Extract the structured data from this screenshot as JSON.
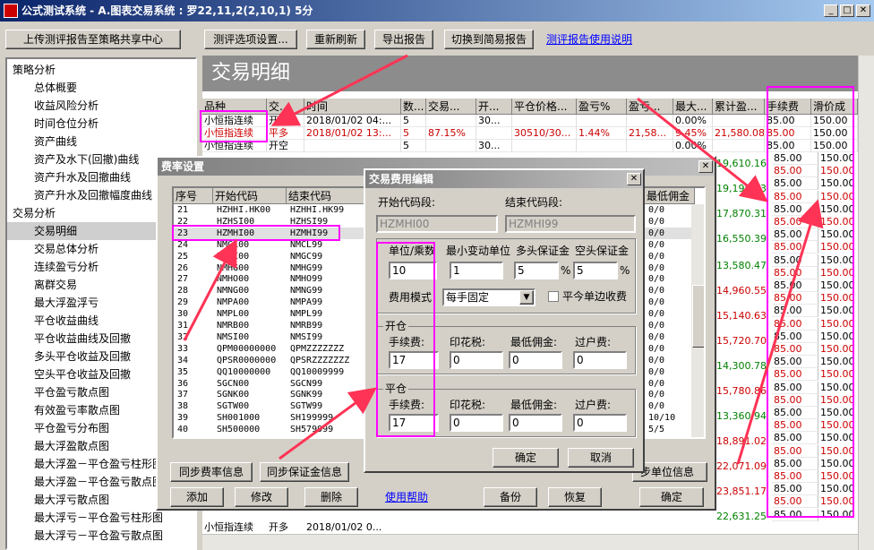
{
  "window": {
    "title": "公式测试系统 - A.图表交易系统 : 罗22,11,2(2,10,1) 5分"
  },
  "toolbar": {
    "upload": "上传测评报告至策略共享中心",
    "options": "测评选项设置...",
    "refresh": "重新刷新",
    "export": "导出报告",
    "simple": "切换到简易报告",
    "help_link": "测评报告使用说明"
  },
  "tree": {
    "group1": "策略分析",
    "group1_items": [
      "总体概要",
      "收益风险分析",
      "时间仓位分析",
      "资产曲线",
      "资产及水下(回撤)曲线",
      "资产升水及回撤曲线",
      "资产升水及回撤幅度曲线"
    ],
    "group2": "交易分析",
    "group2_items": [
      "交易明细",
      "交易总体分析",
      "连续盈亏分析",
      "离群交易",
      "最大浮盈浮亏",
      "平仓收益曲线",
      "平仓收益曲线及回撤",
      "多头平仓收益及回撤",
      "空头平仓收益及回撤",
      "平仓盈亏散点图",
      "有效盈亏率散点图",
      "平仓盈亏分布图",
      "最大浮盈散点图",
      "最大浮盈－平仓盈亏柱形图",
      "最大浮盈－平仓盈亏散点图",
      "最大浮亏散点图",
      "最大浮亏－平仓盈亏柱形图",
      "最大浮亏－平仓盈亏散点图"
    ]
  },
  "report": {
    "heading": "交易明细",
    "columns": [
      "品种",
      "交...",
      "时间",
      "数...",
      "交易...",
      "开...",
      "平仓价格...",
      "盈亏%",
      "盈亏...",
      "最大...",
      "累计盈...",
      "手续费",
      "滑价成"
    ],
    "rows": [
      [
        "小恒指连续",
        "开多",
        "2018/01/02 04:...",
        "5",
        "",
        "30...",
        "",
        "",
        "",
        "0.00%",
        "",
        "85.00",
        "150.00"
      ],
      [
        "小恒指连续",
        "平多",
        "2018/01/02 13:...",
        "5",
        "87.15%",
        "",
        "30510/30...",
        "1.44%",
        "21,58...",
        "9.45%",
        "21,580.08",
        "85.00",
        "150.00"
      ],
      [
        "小恒指连续",
        "开空",
        "",
        "5",
        "",
        "30...",
        "",
        "",
        "",
        "0.00%",
        "",
        "85.00",
        "150.00"
      ]
    ],
    "cum_values": [
      "19,610.16",
      "19,198.23",
      "17,870.31",
      "16,550.39",
      "13,580.47",
      "14,960.55",
      "15,140.63",
      "15,720.70",
      "14,300.78",
      "15,780.86",
      "13,360.94",
      "18,891.02",
      "22,071.09",
      "23,851.17",
      "22,631.25"
    ],
    "fee_values": [
      "85.00",
      "85.00",
      "85.00",
      "85.00",
      "85.00",
      "85.00",
      "85.00",
      "85.00",
      "85.00",
      "85.00",
      "85.00",
      "85.00",
      "85.00",
      "85.00",
      "85.00",
      "85.00",
      "85.00",
      "85.00",
      "85.00",
      "85.00",
      "85.00",
      "85.00",
      "85.00",
      "85.00",
      "85.00",
      "85.00",
      "85.00",
      "85.00",
      "85.00"
    ],
    "slip_values": [
      "150.00",
      "150.00",
      "150.00",
      "150.00",
      "150.00",
      "150.00",
      "150.00",
      "150.00",
      "150.00",
      "150.00",
      "150.00",
      "150.00",
      "150.00",
      "150.00",
      "150.00",
      "150.00",
      "150.00",
      "150.00",
      "150.00",
      "150.00",
      "150.00",
      "150.00",
      "150.00",
      "150.00",
      "150.00",
      "150.00",
      "150.00",
      "150.00",
      "150.00"
    ],
    "bottom_row": [
      "小恒指连续",
      "开多",
      "2018/01/02 0..."
    ]
  },
  "rate_dialog": {
    "title": "费率设置",
    "columns": [
      "序号",
      "开始代码",
      "结束代码",
      "最低佣金"
    ],
    "rows": [
      [
        "21",
        "HZHHI.HK00",
        "HZHHI.HK99",
        "0/0"
      ],
      [
        "22",
        "HZHSI00",
        "HZHSI99",
        "0/0"
      ],
      [
        "23",
        "HZMHI00",
        "HZMHI99",
        "0/0"
      ],
      [
        "24",
        "NMCL00",
        "NMCL99",
        "0/0"
      ],
      [
        "25",
        "NMGC00",
        "NMGC99",
        "0/0"
      ],
      [
        "26",
        "NMHG00",
        "NMHG99",
        "0/0"
      ],
      [
        "27",
        "NMHO00",
        "NMHO99",
        "0/0"
      ],
      [
        "28",
        "NMNG00",
        "NMNG99",
        "0/0"
      ],
      [
        "29",
        "NMPA00",
        "NMPA99",
        "0/0"
      ],
      [
        "30",
        "NMPL00",
        "NMPL99",
        "0/0"
      ],
      [
        "31",
        "NMRB00",
        "NMRB99",
        "0/0"
      ],
      [
        "32",
        "NMSI00",
        "NMSI99",
        "0/0"
      ],
      [
        "33",
        "QPM00000000",
        "QPMZZZZZZZ",
        "0/0"
      ],
      [
        "34",
        "QPSR0000000",
        "QPSRZZZZZZZ",
        "0/0"
      ],
      [
        "35",
        "QQ10000000",
        "QQ10009999",
        "0/0"
      ],
      [
        "36",
        "SGCN00",
        "SGCN99",
        "0/0"
      ],
      [
        "37",
        "SGNK00",
        "SGNK99",
        "0/0"
      ],
      [
        "38",
        "SGTW00",
        "SGTW99",
        "0/0"
      ],
      [
        "39",
        "SH001000",
        "SH199999",
        "10/10"
      ],
      [
        "40",
        "SH500000",
        "SH579999",
        "5/5"
      ]
    ],
    "sync_rate": "同步费率信息",
    "sync_margin": "同步保证金信息",
    "sync_unit": "步单位信息",
    "add": "添加",
    "modify": "修改",
    "delete": "删除",
    "help": "使用帮助",
    "backup": "备份",
    "restore": "恢复",
    "ok": "确定"
  },
  "fee_dialog": {
    "title": "交易费用编辑",
    "start_code_label": "开始代码段:",
    "end_code_label": "结束代码段:",
    "start_code": "HZMHI00",
    "end_code": "HZMHI99",
    "unit_label": "单位/乘数",
    "min_tick_label": "最小变动单位",
    "long_margin_label": "多头保证金",
    "short_margin_label": "空头保证金",
    "unit_value": "10",
    "min_tick_value": "1",
    "long_margin_value": "5",
    "short_margin_value": "5",
    "percent": "%",
    "mode_label": "费用模式",
    "mode_value": "每手固定",
    "single_side_label": "平今单边收费",
    "open_group": "开仓",
    "close_group": "平仓",
    "fee_label": "手续费:",
    "stamp_label": "印花税:",
    "min_comm_label": "最低佣金:",
    "transfer_label": "过户费:",
    "open_fee": "17",
    "open_stamp": "0",
    "open_min": "0",
    "open_transfer": "0",
    "close_fee": "17",
    "close_stamp": "0",
    "close_min": "0",
    "close_transfer": "0",
    "ok": "确定",
    "cancel": "取消"
  },
  "colors": {
    "pink": "#ff00ff",
    "red_arrow": "#ff3355",
    "profit_green": "#008000",
    "loss_red": "#cc0000"
  }
}
